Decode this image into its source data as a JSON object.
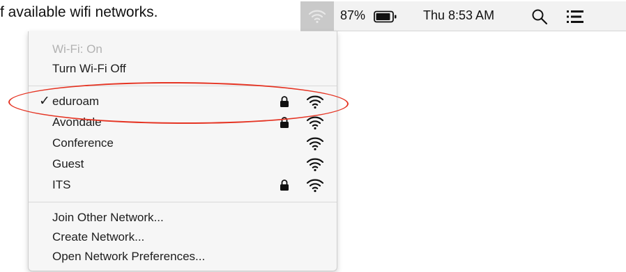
{
  "caption": "f available wifi networks.",
  "menubar": {
    "battery_percent": "87%",
    "clock": "Thu 8:53 AM",
    "icons": [
      "wifi-icon",
      "battery-icon",
      "search-icon",
      "list-icon"
    ]
  },
  "wifi_menu": {
    "status": "Wi-Fi: On",
    "toggle_label": "Turn Wi-Fi Off",
    "networks": [
      {
        "name": "eduroam",
        "connected": true,
        "secured": true
      },
      {
        "name": "Avondale",
        "connected": false,
        "secured": true
      },
      {
        "name": "Conference",
        "connected": false,
        "secured": false
      },
      {
        "name": "Guest",
        "connected": false,
        "secured": false
      },
      {
        "name": "ITS",
        "connected": false,
        "secured": true
      }
    ],
    "check_mark": "✓",
    "join_other": "Join Other Network...",
    "create_network": "Create Network...",
    "open_prefs": "Open Network Preferences..."
  },
  "annotation_color": "#e53423"
}
